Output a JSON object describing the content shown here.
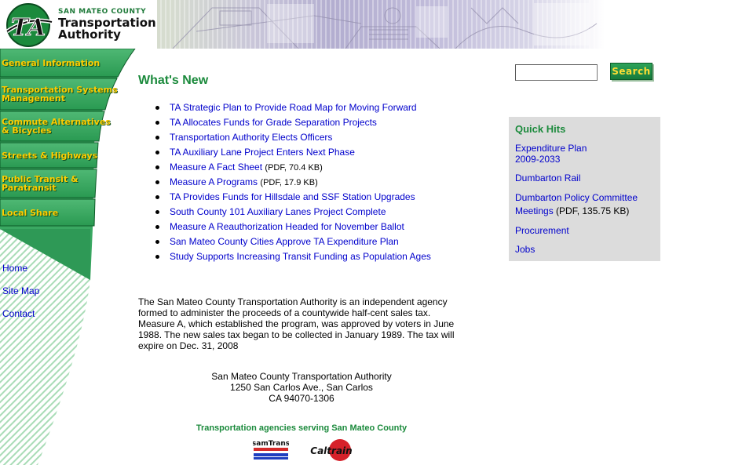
{
  "header": {
    "logo_mark": "TA",
    "county_text": "SAN MATEO COUNTY",
    "name_line1": "Transportation",
    "name_line2": "Authority",
    "brand_green": "#1b8a3c",
    "nav_yellow": "#ffcc00"
  },
  "sidebar": {
    "nav_items": [
      {
        "label_line1": "General Information",
        "label_line2": ""
      },
      {
        "label_line1": "Transportation Systems",
        "label_line2": "Management"
      },
      {
        "label_line1": "Commute Alternatives",
        "label_line2": "& Bicycles"
      },
      {
        "label_line1": "Streets & Highways",
        "label_line2": ""
      },
      {
        "label_line1": "Public Transit &",
        "label_line2": "Paratransit"
      },
      {
        "label_line1": "Local Share",
        "label_line2": ""
      }
    ],
    "links": [
      "Home",
      "Site Map",
      "Contact"
    ]
  },
  "main": {
    "title": "What's New",
    "news": [
      {
        "text": "TA Strategic Plan to Provide Road Map for Moving Forward",
        "note": ""
      },
      {
        "text": "TA Allocates Funds for Grade Separation Projects",
        "note": ""
      },
      {
        "text": "Transportation Authority Elects Officers",
        "note": ""
      },
      {
        "text": "TA Auxiliary Lane Project Enters Next Phase",
        "note": ""
      },
      {
        "text": "Measure A Fact Sheet",
        "note": "(PDF, 70.4 KB)"
      },
      {
        "text": "Measure A Programs",
        "note": "(PDF, 17.9 KB)"
      },
      {
        "text": "TA Provides Funds for Hillsdale and SSF Station Upgrades",
        "note": ""
      },
      {
        "text": "South County 101 Auxiliary Lanes Project Complete",
        "note": ""
      },
      {
        "text": "Measure A Reauthorization Headed for November Ballot",
        "note": ""
      },
      {
        "text": "San Mateo County Cities Approve TA Expenditure Plan",
        "note": ""
      },
      {
        "text": "Study Supports Increasing Transit Funding as Population Ages",
        "note": ""
      }
    ],
    "about": "The San Mateo County Transportation Authority is an independent agency formed to administer the proceeds of a countywide half-cent sales tax. Measure A, which established the program, was approved by voters in June 1988. The new sales tax began to be collected in January 1989. The tax will expire on Dec. 31, 2008",
    "address": [
      "San Mateo County Transportation Authority",
      "1250 San Carlos Ave., San Carlos",
      "CA 94070-1306"
    ],
    "agencies_title": "Transportation agencies serving San Mateo County",
    "agency_logos": [
      {
        "name": "samtrans-logo",
        "text": "samTrans"
      },
      {
        "name": "caltrain-logo",
        "text": "Caltrain"
      }
    ]
  },
  "search": {
    "value": "",
    "button_label": "Search"
  },
  "quick_hits": {
    "title": "Quick Hits",
    "items": [
      {
        "line1": "Expenditure Plan",
        "line2": "2009-2033",
        "note": ""
      },
      {
        "line1": "Dumbarton Rail",
        "line2": "",
        "note": ""
      },
      {
        "line1": "Dumbarton Policy Committee",
        "line2": "Meetings",
        "note": "(PDF, 135.75 KB)"
      },
      {
        "line1": "Procurement",
        "line2": "",
        "note": ""
      },
      {
        "line1": "Jobs",
        "line2": "",
        "note": ""
      }
    ]
  }
}
